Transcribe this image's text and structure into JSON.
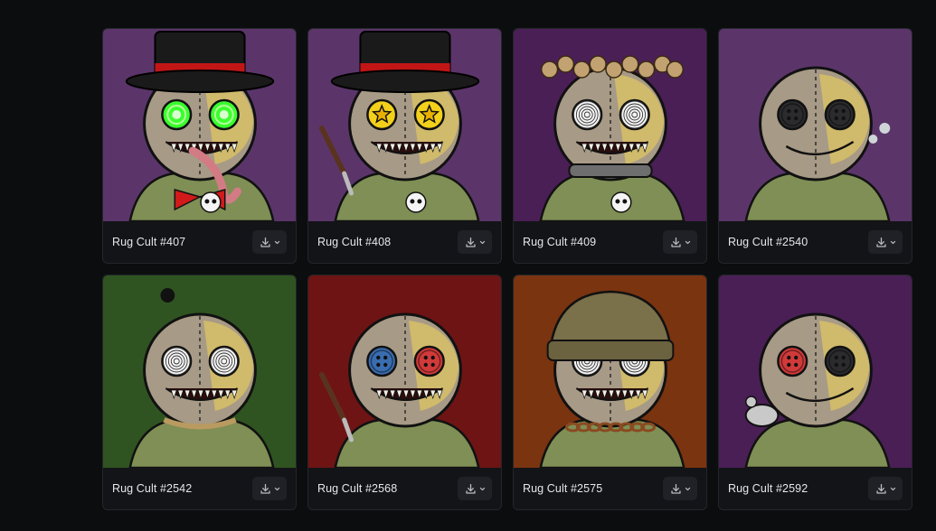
{
  "gallery": {
    "items": [
      {
        "name": "Rug Cult #407",
        "bg": "#5b356a",
        "eyes": "neon",
        "hat": "tophat",
        "extra": "tongue"
      },
      {
        "name": "Rug Cult #408",
        "bg": "#5b356a",
        "eyes": "star",
        "hat": "tophat",
        "extra": "knife"
      },
      {
        "name": "Rug Cult #409",
        "bg": "#4a1f55",
        "eyes": "spiral",
        "hat": "flowers",
        "extra": "collar"
      },
      {
        "name": "Rug Cult #2540",
        "bg": "#5b356a",
        "eyes": "button",
        "hat": "none",
        "extra": "smoke"
      },
      {
        "name": "Rug Cult #2542",
        "bg": "#2f5421",
        "eyes": "spiral",
        "hat": "spider",
        "extra": "rope"
      },
      {
        "name": "Rug Cult #2568",
        "bg": "#6e1414",
        "eyes": "buttonc",
        "hat": "none",
        "extra": "knife"
      },
      {
        "name": "Rug Cult #2575",
        "bg": "#7a3410",
        "eyes": "spiral",
        "hat": "beanie",
        "extra": "chain"
      },
      {
        "name": "Rug Cult #2592",
        "bg": "#4a1f55",
        "eyes": "buttonr",
        "hat": "none",
        "extra": "rat"
      }
    ],
    "download_icon": "download-icon",
    "chevron_icon": "chevron-down-icon"
  },
  "colors": {
    "page_bg": "#0c0d0f",
    "card_bg": "#131417",
    "button_bg": "#1f2126",
    "text": "#e6e7ea"
  }
}
